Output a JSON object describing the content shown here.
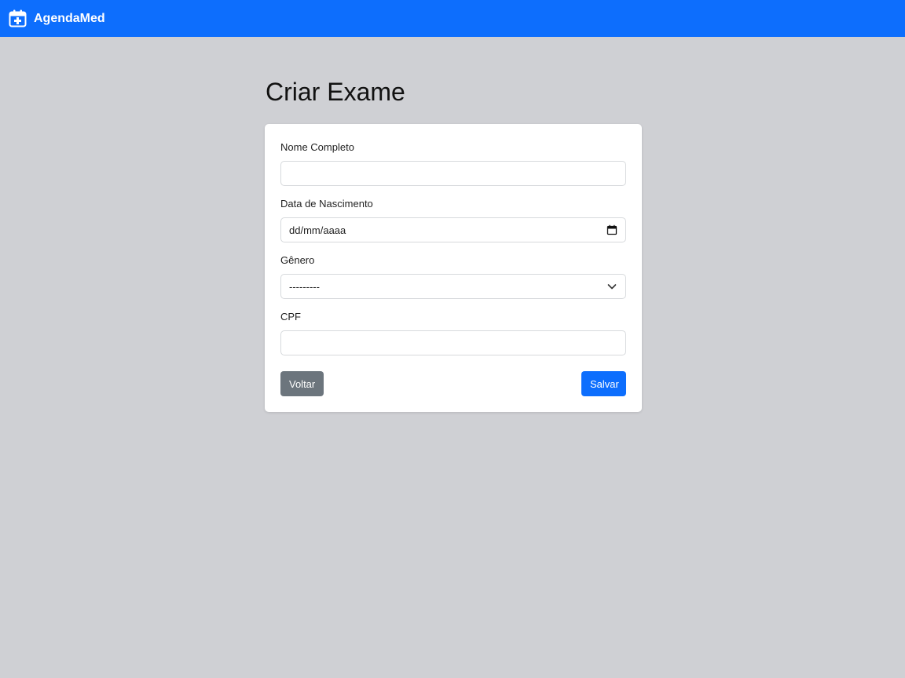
{
  "navbar": {
    "brand": "AgendaMed",
    "brand_icon": "calendar-plus-icon",
    "background_color": "#0d6efd"
  },
  "page": {
    "title": "Criar Exame"
  },
  "form": {
    "name": {
      "label": "Nome Completo",
      "value": ""
    },
    "birth_date": {
      "label": "Data de Nascimento",
      "placeholder": "dd/mm/aaaa",
      "icon": "calendar-icon"
    },
    "gender": {
      "label": "Gênero",
      "selected": "---------",
      "icon": "chevron-down-icon"
    },
    "cpf": {
      "label": "CPF",
      "value": ""
    },
    "back_label": "Voltar",
    "save_label": "Salvar"
  },
  "colors": {
    "primary": "#0d6efd",
    "secondary": "#6c757d",
    "page_background": "#cfd0d4"
  }
}
